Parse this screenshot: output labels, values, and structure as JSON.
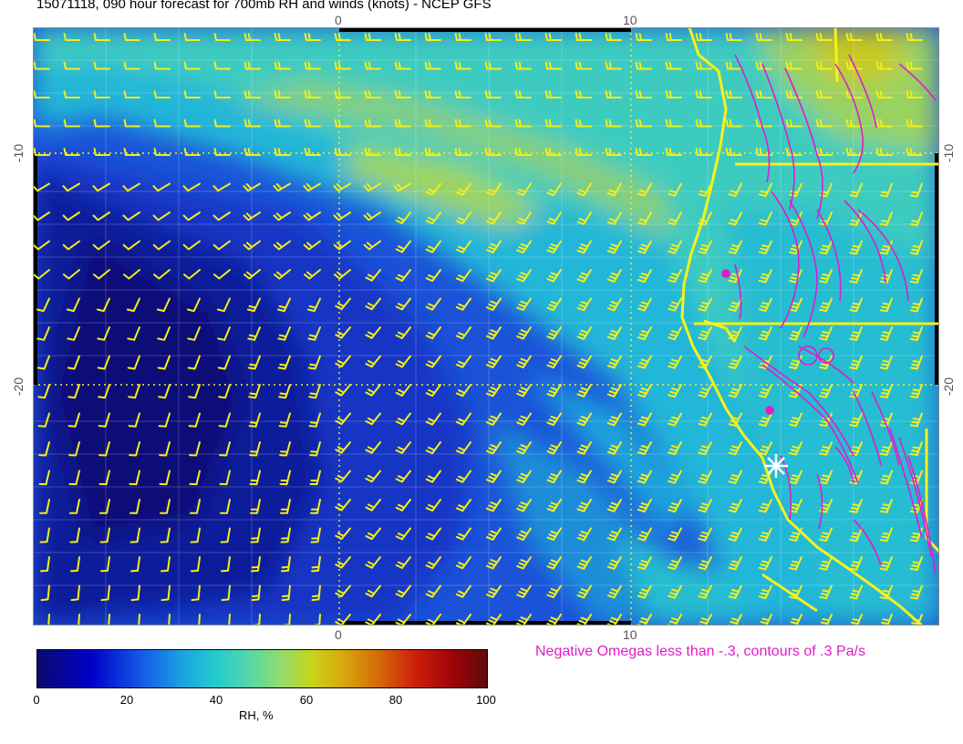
{
  "title": "15071118, 090 hour forecast for 700mb RH and winds (knots) - NCEP GFS",
  "axes": {
    "top_ticks": [
      "0",
      "10"
    ],
    "bottom_ticks": [
      "0",
      "10"
    ],
    "left_ticks": [
      "-10",
      "-20"
    ],
    "right_ticks": [
      "-10",
      "-20"
    ]
  },
  "colorbar": {
    "ticks": [
      "0",
      "20",
      "40",
      "60",
      "80",
      "100"
    ],
    "label": "RH, %"
  },
  "omega_note": "Negative Omegas less than -.3, contours of .3 Pa/s",
  "colors": {
    "wind_barbs": "#f2ee1a",
    "coastline": "#f6f21a",
    "omega_contours": "#e01ccc",
    "rh_low": "#0a0a6e",
    "rh_high": "#5e0a0a"
  },
  "icons": {
    "marker": "white-star-marker-icon"
  }
}
